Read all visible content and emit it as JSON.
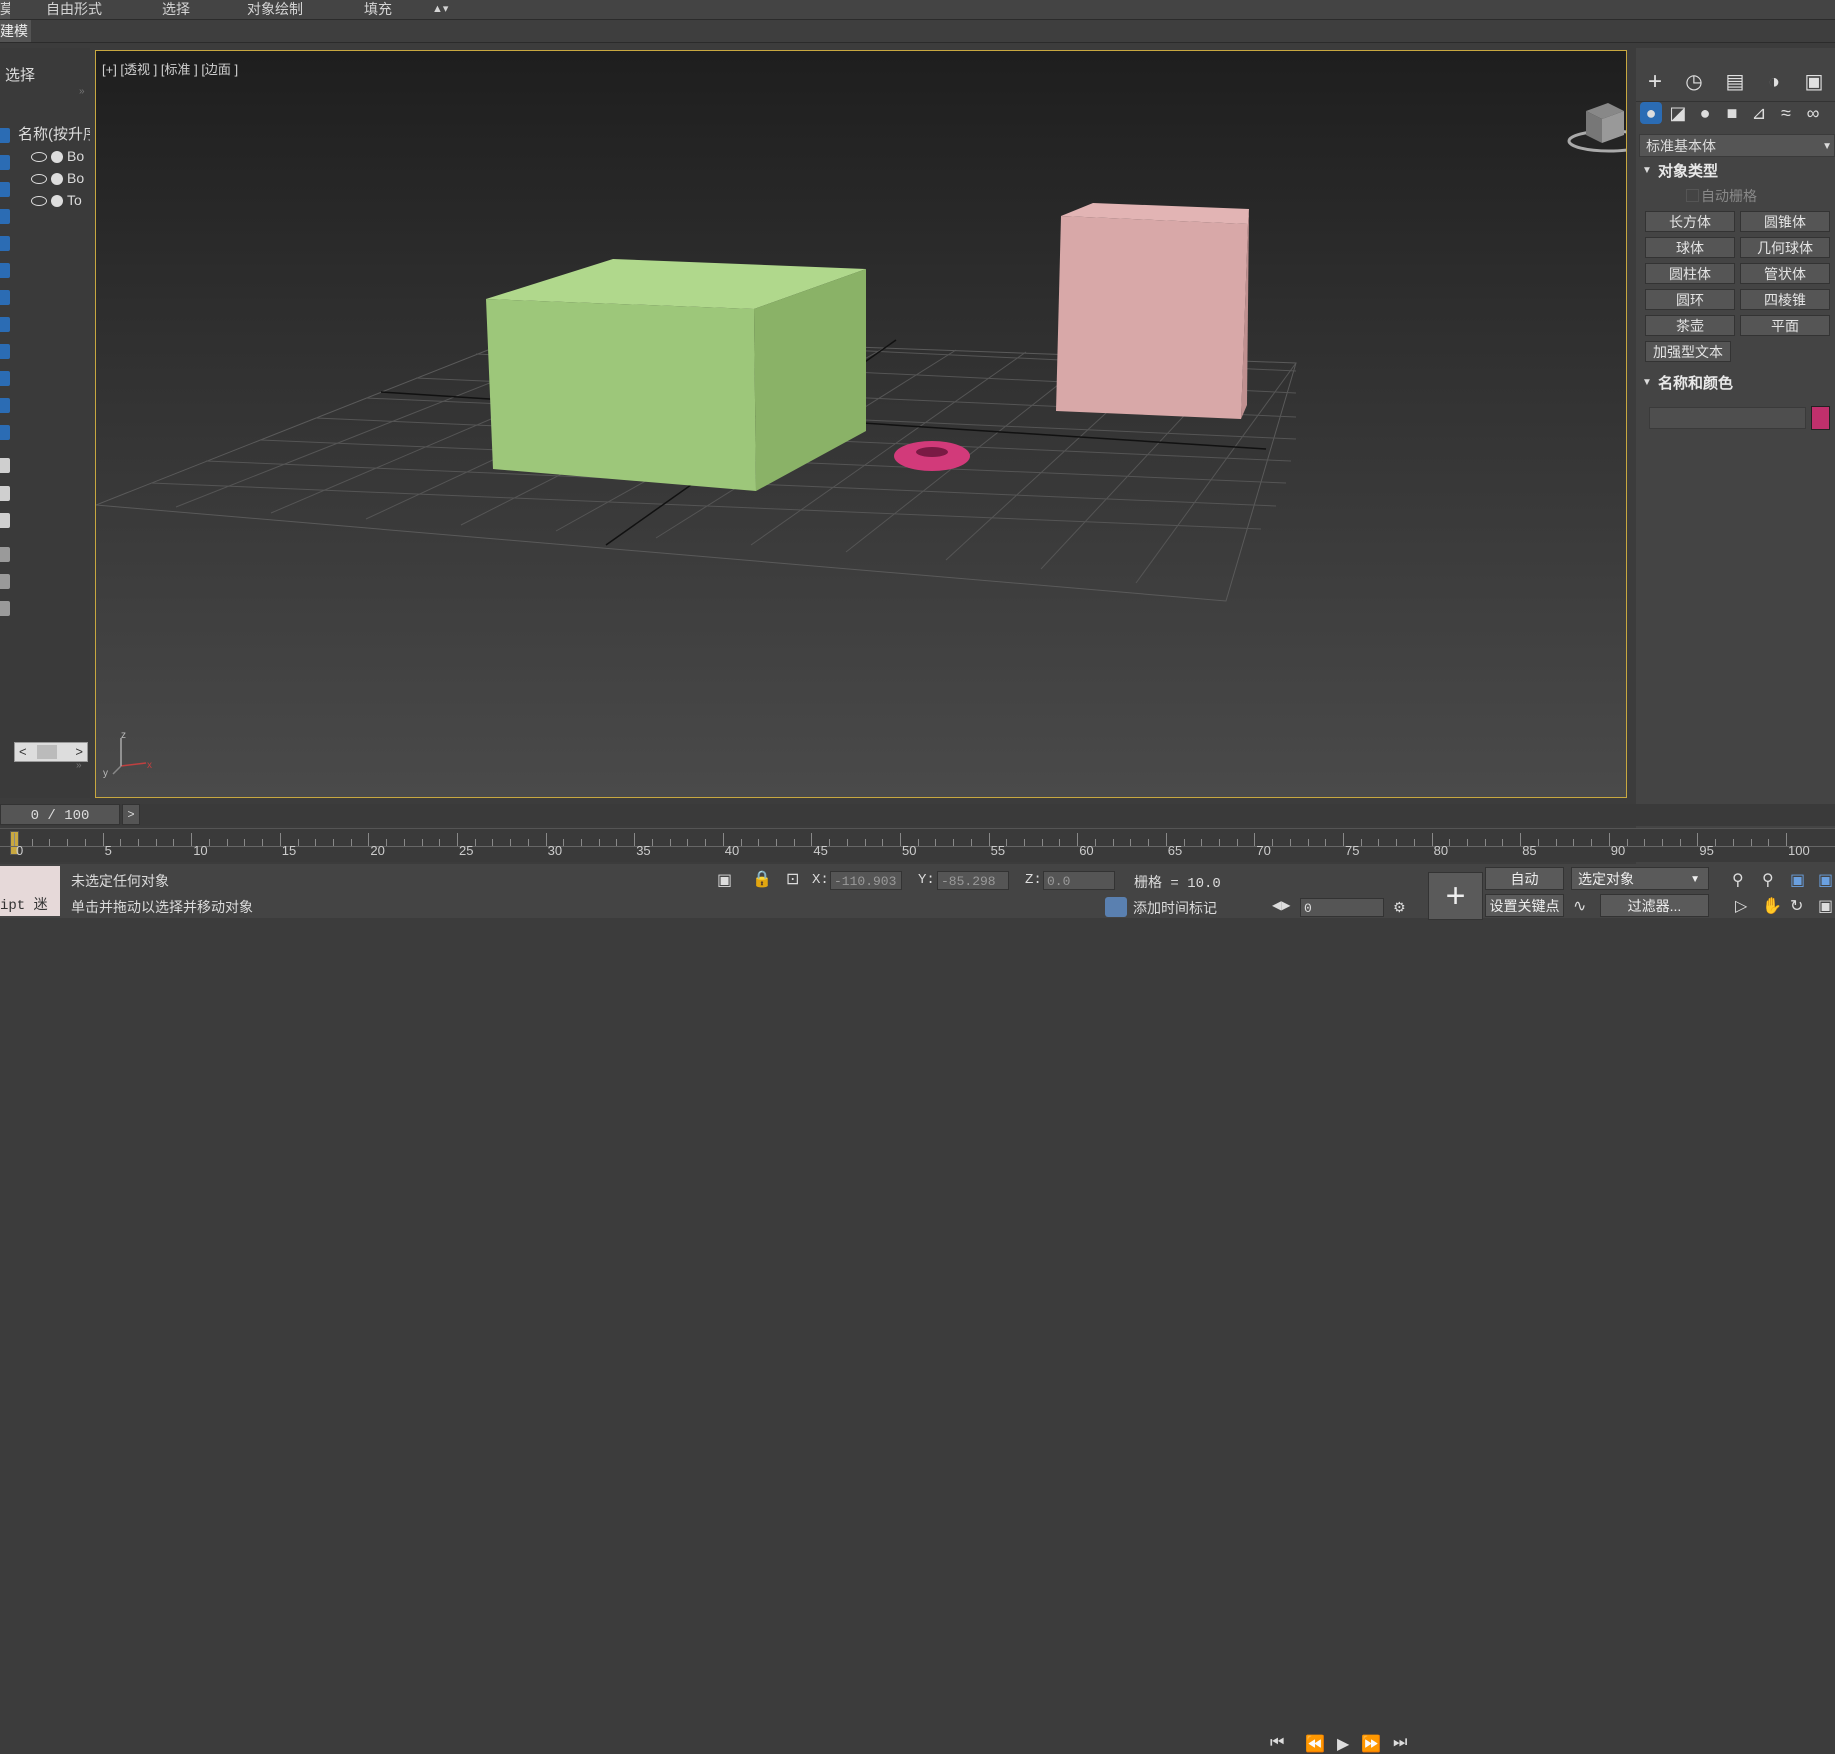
{
  "menubar": {
    "first_partial": "莫",
    "items": [
      "自由形式",
      "选择",
      "对象绘制",
      "填充"
    ]
  },
  "ribbon": {
    "active_tab": "建模"
  },
  "scene_explorer": {
    "title": "选择",
    "column_header": "名称(按升序",
    "rows": [
      {
        "label": "Bo"
      },
      {
        "label": "Bo"
      },
      {
        "label": "To"
      }
    ]
  },
  "viewport": {
    "label": "[+] [透视 ] [标准 ] [边面 ]",
    "colors": {
      "box_green": "#9dc77a",
      "box_pink": "#d8a8a8",
      "torus": "#d23a7a",
      "border": "#c8a840"
    }
  },
  "command_panel": {
    "category_dropdown": "标准基本体",
    "object_type": {
      "title": "对象类型",
      "autogrid_label": "自动栅格",
      "buttons": [
        "长方体",
        "圆锥体",
        "球体",
        "几何球体",
        "圆柱体",
        "管状体",
        "圆环",
        "四棱锥",
        "茶壶",
        "平面",
        "加强型文本"
      ]
    },
    "name_color": {
      "title": "名称和颜色",
      "swatch_color": "#c0306c"
    }
  },
  "timeline": {
    "frame_display": "0 / 100",
    "ticks": [
      "0",
      "5",
      "10",
      "15",
      "20",
      "25",
      "30",
      "35",
      "40",
      "45",
      "50",
      "55",
      "60",
      "65",
      "70",
      "75",
      "80",
      "85",
      "90",
      "95",
      "100"
    ]
  },
  "status": {
    "script_text": "ipt 迷",
    "line1": "未选定任何对象",
    "line2": "单击并拖动以选择并移动对象",
    "x_label": "X:",
    "x_value": "-110.903",
    "y_label": "Y:",
    "y_value": "-85.298",
    "z_label": "Z:",
    "z_value": "0.0",
    "grid": "栅格 = 10.0",
    "add_time_tag": "添加时间标记",
    "auto_key": "自动",
    "selected_object": "选定对象",
    "set_key": "设置关键点",
    "filters": "过滤器...",
    "frame_field": "0"
  }
}
